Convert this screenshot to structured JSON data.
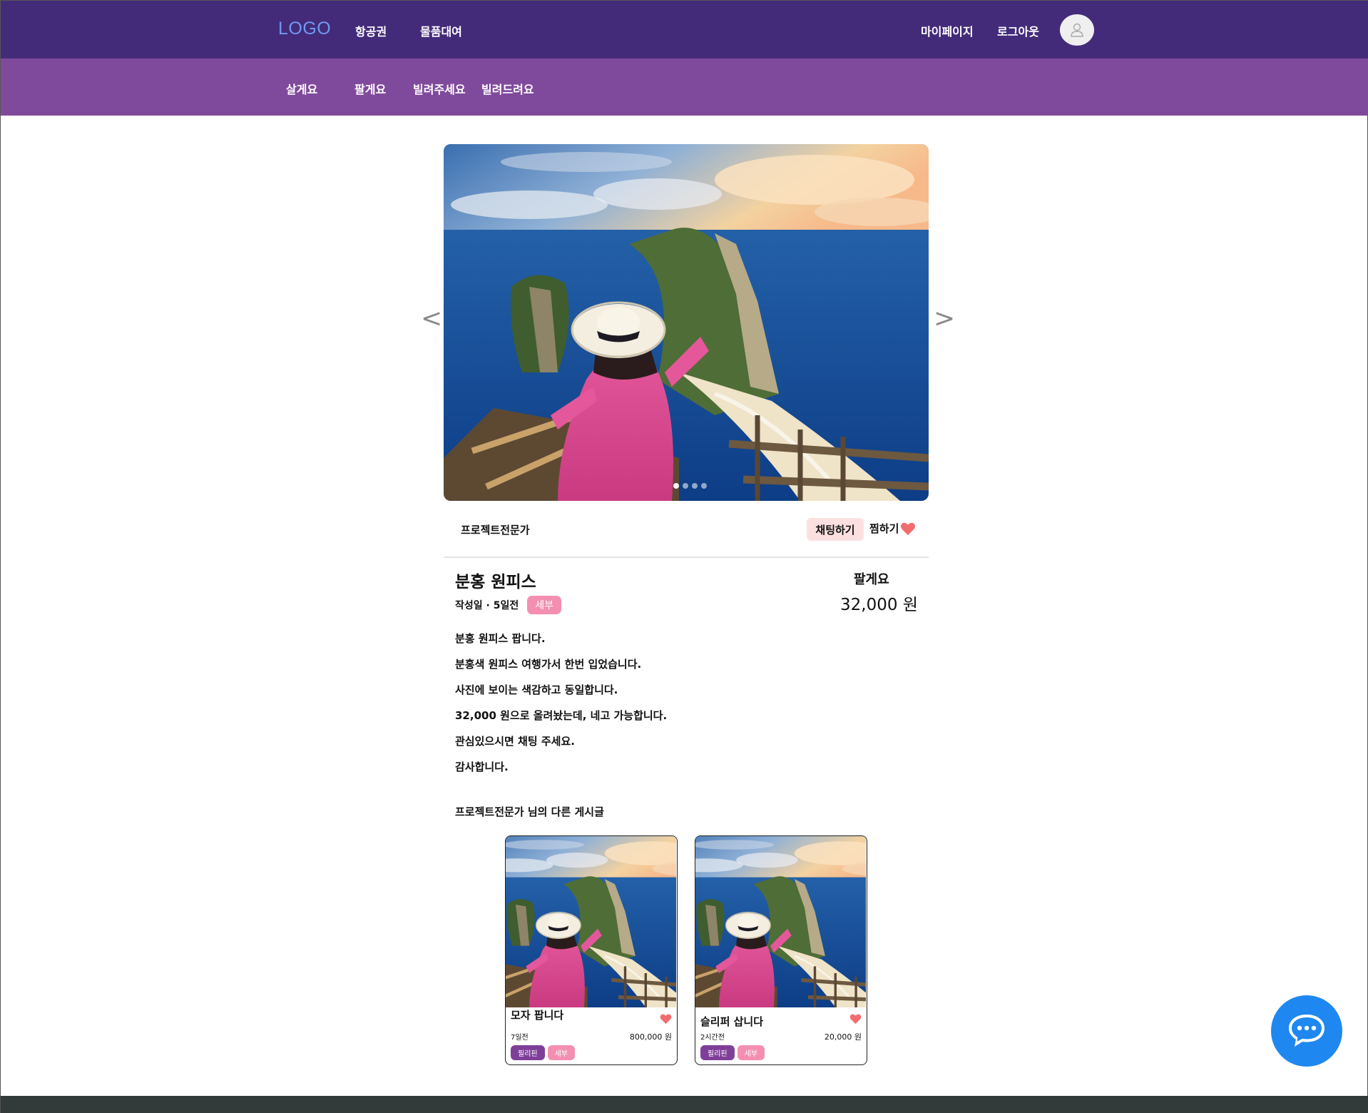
{
  "header": {
    "logo": "LOGO",
    "nav": [
      "항공권",
      "물품대여"
    ],
    "mypage": "마이페이지",
    "logout": "로그아웃",
    "avatar_icon": "user-icon"
  },
  "subnav": [
    "살게요",
    "팔게요",
    "빌려주세요",
    "빌려드려요"
  ],
  "carousel": {
    "prev": "<",
    "next": ">",
    "slide_count": 4,
    "active_slide": 0
  },
  "seller": {
    "name": "프로젝트전문가",
    "chat_label": "채팅하기",
    "like_label": "찜하기"
  },
  "post": {
    "title": "분홍 원피스",
    "date": "작성일 · 5일전",
    "location_tag": "세부",
    "deal_type": "팔게요",
    "price": "32,000 원",
    "description": [
      "분홍 원피스 팝니다.",
      "분홍색 원피스 여행가서 한번 입었습니다.",
      "사진에 보이는 색감하고 동일합니다.",
      "32,000 원으로 올려놨는데, 네고 가능합니다.",
      "관심있으시면 채팅 주세요.",
      "감사합니다."
    ]
  },
  "other_posts": {
    "heading": "프로젝트전문가 님의 다른 게시글",
    "items": [
      {
        "title": "모자 팝니다",
        "time": "7일전",
        "price": "800,000 원",
        "tags": [
          "필리핀",
          "세부"
        ]
      },
      {
        "title": "슬리퍼 삽니다",
        "time": "2시간전",
        "price": "20,000 원",
        "tags": [
          "필리핀",
          "세부"
        ]
      }
    ]
  },
  "colors": {
    "top_nav": "#432b7a",
    "sub_nav": "#804a9c",
    "logo": "#6f9bf0",
    "chat_button_bg": "#fce0e0",
    "heart": "#f26d6d",
    "tag_pink": "#f48fb1",
    "tag_purple": "#7f3f98",
    "chat_fab": "#1e88f0",
    "footer": "#333a3a"
  },
  "floating_chat_icon": "chat-bubble-icon"
}
